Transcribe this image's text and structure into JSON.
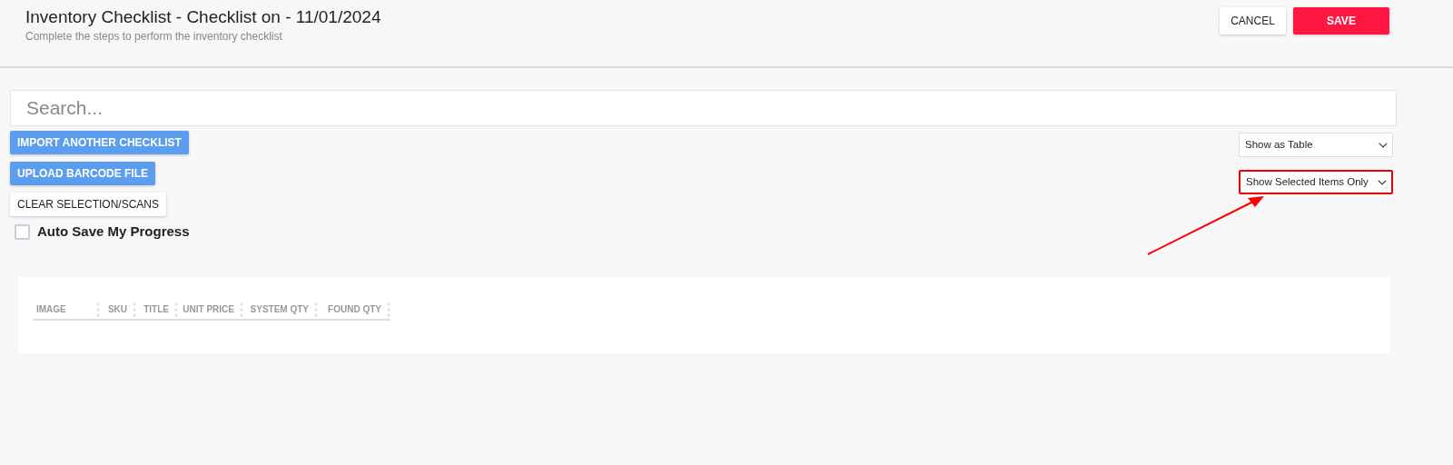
{
  "header": {
    "title": "Inventory Checklist - Checklist on - 11/01/2024",
    "subtitle": "Complete the steps to perform the inventory checklist",
    "buttons": [
      {
        "label": "CANCEL",
        "kind": "secondary"
      },
      {
        "label": "SAVE",
        "kind": "primary"
      }
    ]
  },
  "search": {
    "placeholder": "Search..."
  },
  "actions": [
    {
      "label": "IMPORT ANOTHER CHECKLIST",
      "kind": "primary"
    },
    {
      "label": "UPLOAD BARCODE FILE",
      "kind": "primary"
    },
    {
      "label": "CLEAR SELECTION/SCANS",
      "kind": "secondary"
    }
  ],
  "selects": [
    {
      "value": "Show as Table",
      "highlighted": false
    },
    {
      "value": "Show Selected Items Only",
      "highlighted": true
    }
  ],
  "auto_save": {
    "label": "Auto Save My Progress",
    "checked": false
  },
  "table": {
    "columns": [
      "IMAGE",
      "SKU",
      "TITLE",
      "UNIT PRICE",
      "SYSTEM QTY",
      "FOUND QTY"
    ]
  }
}
